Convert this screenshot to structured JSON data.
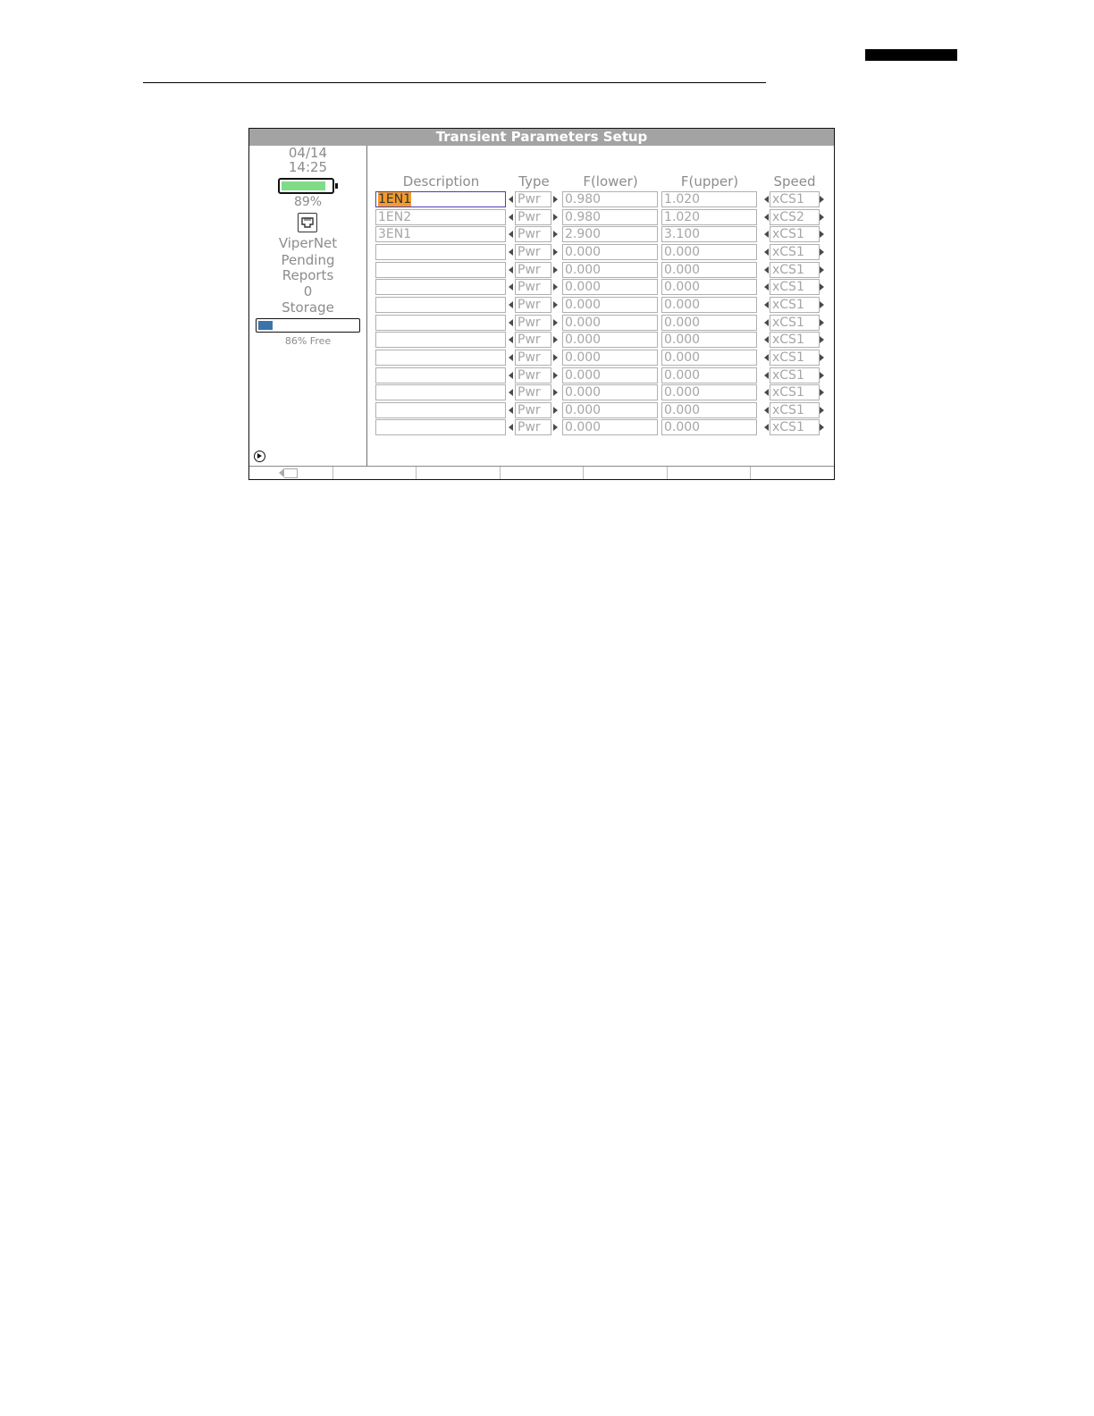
{
  "screen": {
    "title": "Transient Parameters Setup",
    "sidebar": {
      "date": "04/14",
      "time": "14:25",
      "battery_percent": "89%",
      "battery_level": 0.89,
      "net_label": "ViperNet",
      "pending_label_1": "Pending",
      "pending_label_2": "Reports",
      "pending_count": "0",
      "storage_label": "Storage",
      "storage_free_label": "86% Free",
      "storage_used_fraction": 0.14
    },
    "table": {
      "headers": {
        "description": "Description",
        "type": "Type",
        "f_lower": "F(lower)",
        "f_upper": "F(upper)",
        "speed": "Speed"
      },
      "rows": [
        {
          "desc": "1EN1",
          "type": "Pwr",
          "flow": "0.980",
          "fup": "1.020",
          "speed": "xCS1"
        },
        {
          "desc": "1EN2",
          "type": "Pwr",
          "flow": "0.980",
          "fup": "1.020",
          "speed": "xCS2"
        },
        {
          "desc": "3EN1",
          "type": "Pwr",
          "flow": "2.900",
          "fup": "3.100",
          "speed": "xCS1"
        },
        {
          "desc": "",
          "type": "Pwr",
          "flow": "0.000",
          "fup": "0.000",
          "speed": "xCS1"
        },
        {
          "desc": "",
          "type": "Pwr",
          "flow": "0.000",
          "fup": "0.000",
          "speed": "xCS1"
        },
        {
          "desc": "",
          "type": "Pwr",
          "flow": "0.000",
          "fup": "0.000",
          "speed": "xCS1"
        },
        {
          "desc": "",
          "type": "Pwr",
          "flow": "0.000",
          "fup": "0.000",
          "speed": "xCS1"
        },
        {
          "desc": "",
          "type": "Pwr",
          "flow": "0.000",
          "fup": "0.000",
          "speed": "xCS1"
        },
        {
          "desc": "",
          "type": "Pwr",
          "flow": "0.000",
          "fup": "0.000",
          "speed": "xCS1"
        },
        {
          "desc": "",
          "type": "Pwr",
          "flow": "0.000",
          "fup": "0.000",
          "speed": "xCS1"
        },
        {
          "desc": "",
          "type": "Pwr",
          "flow": "0.000",
          "fup": "0.000",
          "speed": "xCS1"
        },
        {
          "desc": "",
          "type": "Pwr",
          "flow": "0.000",
          "fup": "0.000",
          "speed": "xCS1"
        },
        {
          "desc": "",
          "type": "Pwr",
          "flow": "0.000",
          "fup": "0.000",
          "speed": "xCS1"
        },
        {
          "desc": "",
          "type": "Pwr",
          "flow": "0.000",
          "fup": "0.000",
          "speed": "xCS1"
        }
      ]
    },
    "icons": {
      "network": "ethernet-port-icon",
      "play": "play-circle-icon",
      "backspace": "backspace-icon"
    },
    "colors": {
      "title_bar": "#a3a3a3",
      "battery_fill": "#7fdb85",
      "storage_fill": "#3c74aa",
      "selection_highlight": "#f39c2a",
      "selected_border": "#4a3fb8"
    }
  }
}
